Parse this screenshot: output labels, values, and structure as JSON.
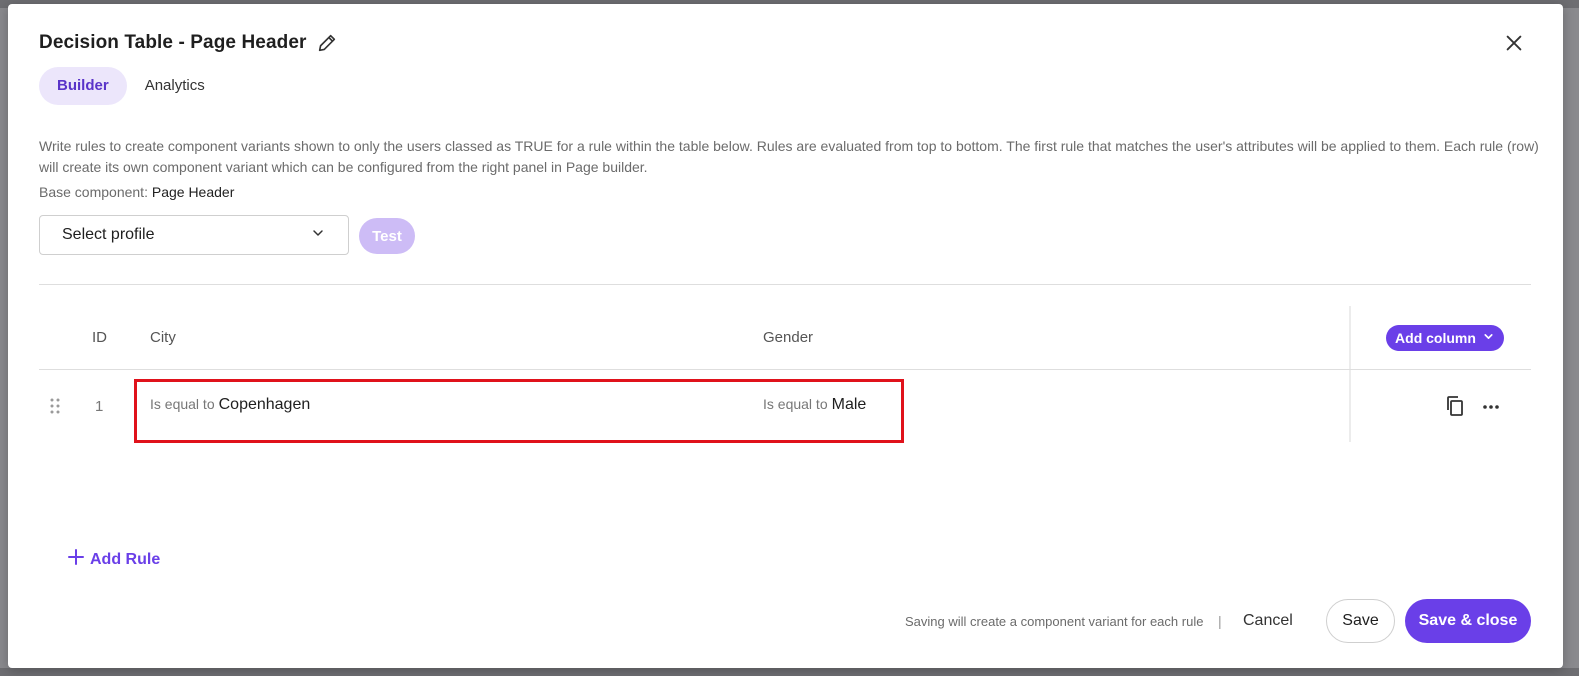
{
  "dialog": {
    "title": "Decision Table - Page Header",
    "tabs": [
      {
        "label": "Builder",
        "active": true
      },
      {
        "label": "Analytics",
        "active": false
      }
    ],
    "description": "Write rules to create component variants shown to only the users classed as TRUE for a rule within the table below. Rules are evaluated from top to bottom. The first rule that matches the user's attributes will be applied to them. Each rule (row) will create its own component variant which can be configured from the right panel in Page builder.",
    "base_component_label": "Base component:",
    "base_component_value": "Page Header",
    "profile_select": {
      "value": "Select profile",
      "icon": "chevron-down-icon"
    },
    "test_button": "Test"
  },
  "table": {
    "headers": {
      "id": "ID",
      "city": "City",
      "gender": "Gender"
    },
    "add_column_button": "Add column",
    "rows": [
      {
        "id": "1",
        "city": {
          "operator": "Is equal to",
          "value": "Copenhagen"
        },
        "gender": {
          "operator": "Is equal to",
          "value": "Male"
        }
      }
    ]
  },
  "add_rule": "Add Rule",
  "footer": {
    "note": "Saving will create a component variant for each rule",
    "separator": "|",
    "cancel": "Cancel",
    "save": "Save",
    "save_close": "Save & close"
  },
  "colors": {
    "accent": "#6a3fe8",
    "tab_active_bg": "#ece6fb",
    "test_disabled": "#cdbcf6",
    "highlight": "#e0121b"
  }
}
